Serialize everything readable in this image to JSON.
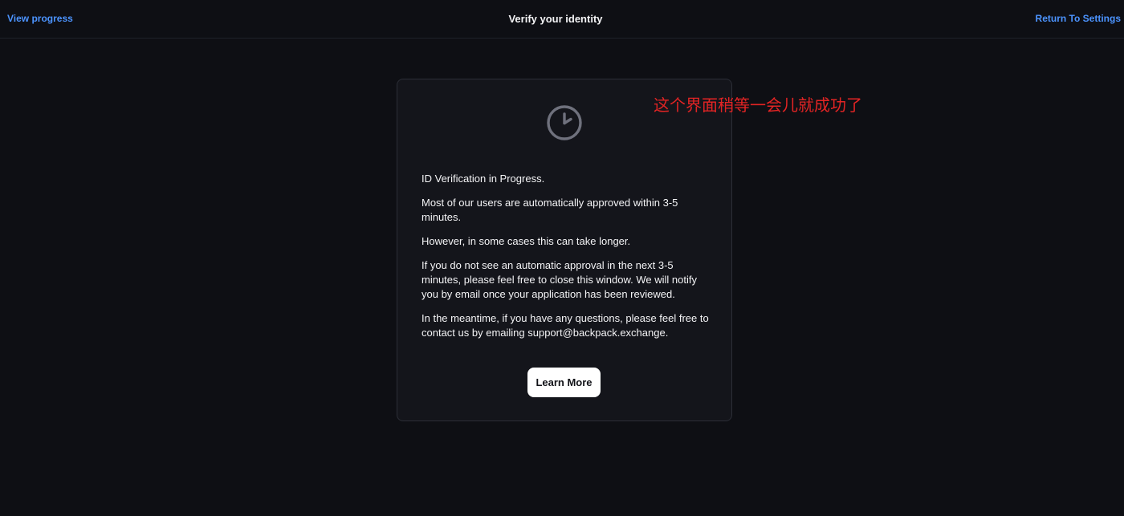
{
  "header": {
    "left_link": "View progress",
    "title": "Verify your identity",
    "right_link": "Return To Settings",
    "link_color": "#4c94ff"
  },
  "card": {
    "icon": "clock-icon",
    "paragraphs": [
      "ID Verification in Progress.",
      "Most of our users are automatically approved within 3-5 minutes.",
      "However, in some cases this can take longer.",
      "If you do not see an automatic approval in the next 3-5 minutes, please feel free to close this window. We will notify you by email once your application has been reviewed.",
      "In the meantime, if you have any questions, please feel free to contact us by emailing support@backpack.exchange."
    ],
    "button_label": "Learn More"
  },
  "annotation": {
    "text": "这个界面稍等一会儿就成功了",
    "color": "#e32424"
  }
}
